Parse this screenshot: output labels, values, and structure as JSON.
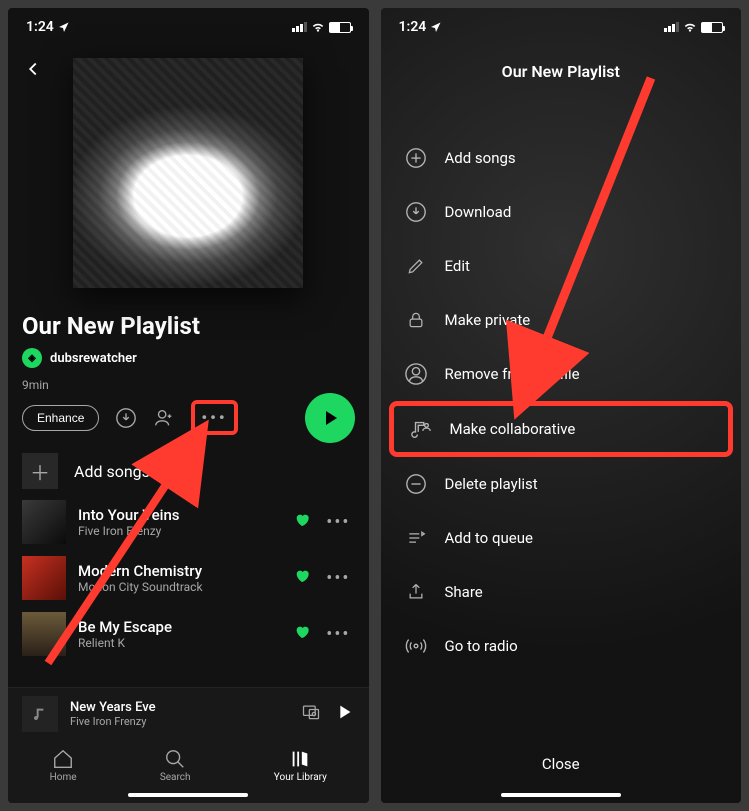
{
  "status": {
    "time": "1:24"
  },
  "left": {
    "playlist_title": "Our New Playlist",
    "owner": "dubsrewatcher",
    "duration": "9min",
    "enhance_label": "Enhance",
    "add_songs_label": "Add songs",
    "tracks": [
      {
        "name": "Into Your Veins",
        "artist": "Five Iron Frenzy"
      },
      {
        "name": "Modern Chemistry",
        "artist": "Motion City Soundtrack"
      },
      {
        "name": "Be My Escape",
        "artist": "Relient K"
      }
    ],
    "now_playing": {
      "name": "New Years Eve",
      "artist": "Five Iron Frenzy"
    },
    "nav": {
      "home": "Home",
      "search": "Search",
      "library": "Your Library"
    }
  },
  "right": {
    "title": "Our New Playlist",
    "menu": [
      {
        "label": "Add songs",
        "icon": "plus-circle-icon"
      },
      {
        "label": "Download",
        "icon": "download-icon"
      },
      {
        "label": "Edit",
        "icon": "pencil-icon"
      },
      {
        "label": "Make private",
        "icon": "lock-icon"
      },
      {
        "label": "Remove from profile",
        "icon": "person-remove-icon"
      },
      {
        "label": "Make collaborative",
        "icon": "collaborative-icon",
        "highlight": true
      },
      {
        "label": "Delete playlist",
        "icon": "minus-circle-icon"
      },
      {
        "label": "Add to queue",
        "icon": "queue-icon"
      },
      {
        "label": "Share",
        "icon": "share-icon"
      },
      {
        "label": "Go to radio",
        "icon": "radio-icon"
      }
    ],
    "close_label": "Close"
  },
  "annotation": {
    "color": "#ff3b2f"
  }
}
